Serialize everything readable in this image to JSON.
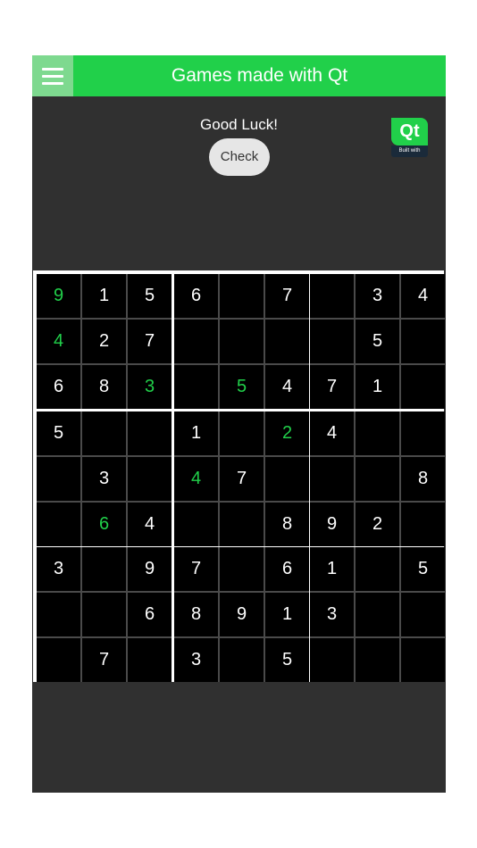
{
  "header": {
    "title": "Games made with Qt"
  },
  "status": {
    "text": "Good Luck!"
  },
  "check_button": {
    "label": "Check"
  },
  "qt_badge": {
    "logo_text": "Qt",
    "caption": "Built with"
  },
  "colors": {
    "accent": "#21d04a",
    "background": "#303030",
    "cell": "#000000"
  },
  "board": {
    "values": [
      [
        "9",
        "1",
        "5",
        "6",
        "",
        "7",
        "",
        "3",
        "4"
      ],
      [
        "4",
        "2",
        "7",
        "",
        "",
        "",
        "",
        "5",
        ""
      ],
      [
        "6",
        "8",
        "3",
        "",
        "5",
        "4",
        "7",
        "1",
        ""
      ],
      [
        "5",
        "",
        "",
        "1",
        "",
        "2",
        "4",
        "",
        ""
      ],
      [
        "",
        "3",
        "",
        "4",
        "7",
        "",
        "",
        "",
        "8"
      ],
      [
        "",
        "6",
        "4",
        "",
        "",
        "8",
        "9",
        "2",
        ""
      ],
      [
        "3",
        "",
        "9",
        "7",
        "",
        "6",
        "1",
        "",
        "5"
      ],
      [
        "",
        "",
        "6",
        "8",
        "9",
        "1",
        "3",
        "",
        ""
      ],
      [
        "",
        "7",
        "",
        "3",
        "",
        "5",
        "",
        "",
        ""
      ]
    ],
    "user_entered": [
      [
        0,
        0
      ],
      [
        1,
        0
      ],
      [
        2,
        2
      ],
      [
        2,
        4
      ],
      [
        3,
        5
      ],
      [
        4,
        3
      ],
      [
        5,
        1
      ]
    ]
  }
}
